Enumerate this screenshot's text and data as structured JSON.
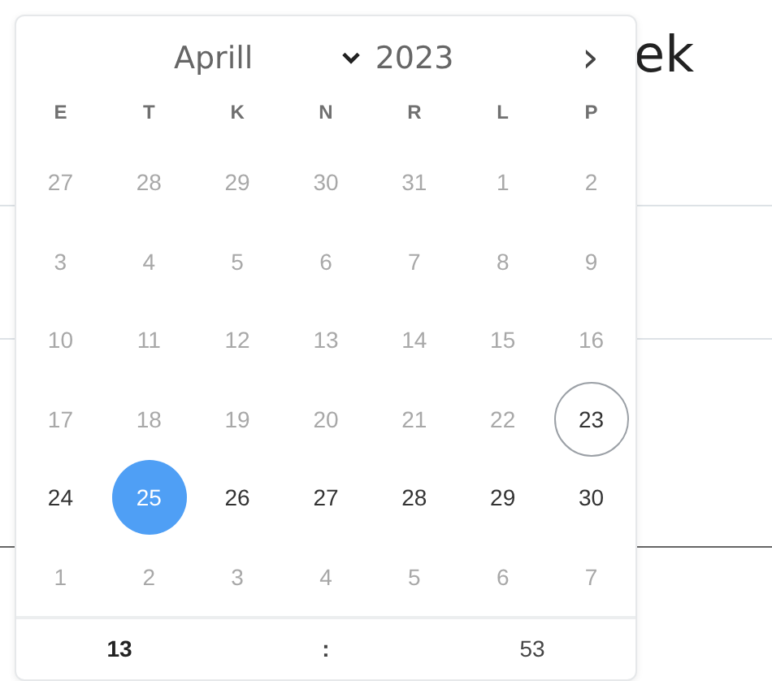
{
  "page": {
    "title": "ek"
  },
  "calendar": {
    "month": "Aprill",
    "year": "2023",
    "next": "›",
    "weekdays": [
      "E",
      "T",
      "K",
      "N",
      "R",
      "L",
      "P"
    ],
    "weeks": [
      [
        {
          "label": "27",
          "disabled": true,
          "today": false,
          "selected": false
        },
        {
          "label": "28",
          "disabled": true,
          "today": false,
          "selected": false
        },
        {
          "label": "29",
          "disabled": true,
          "today": false,
          "selected": false
        },
        {
          "label": "30",
          "disabled": true,
          "today": false,
          "selected": false
        },
        {
          "label": "31",
          "disabled": true,
          "today": false,
          "selected": false
        },
        {
          "label": "1",
          "disabled": true,
          "today": false,
          "selected": false
        },
        {
          "label": "2",
          "disabled": true,
          "today": false,
          "selected": false
        }
      ],
      [
        {
          "label": "3",
          "disabled": true,
          "today": false,
          "selected": false
        },
        {
          "label": "4",
          "disabled": true,
          "today": false,
          "selected": false
        },
        {
          "label": "5",
          "disabled": true,
          "today": false,
          "selected": false
        },
        {
          "label": "6",
          "disabled": true,
          "today": false,
          "selected": false
        },
        {
          "label": "7",
          "disabled": true,
          "today": false,
          "selected": false
        },
        {
          "label": "8",
          "disabled": true,
          "today": false,
          "selected": false
        },
        {
          "label": "9",
          "disabled": true,
          "today": false,
          "selected": false
        }
      ],
      [
        {
          "label": "10",
          "disabled": true,
          "today": false,
          "selected": false
        },
        {
          "label": "11",
          "disabled": true,
          "today": false,
          "selected": false
        },
        {
          "label": "12",
          "disabled": true,
          "today": false,
          "selected": false
        },
        {
          "label": "13",
          "disabled": true,
          "today": false,
          "selected": false
        },
        {
          "label": "14",
          "disabled": true,
          "today": false,
          "selected": false
        },
        {
          "label": "15",
          "disabled": true,
          "today": false,
          "selected": false
        },
        {
          "label": "16",
          "disabled": true,
          "today": false,
          "selected": false
        }
      ],
      [
        {
          "label": "17",
          "disabled": true,
          "today": false,
          "selected": false
        },
        {
          "label": "18",
          "disabled": true,
          "today": false,
          "selected": false
        },
        {
          "label": "19",
          "disabled": true,
          "today": false,
          "selected": false
        },
        {
          "label": "20",
          "disabled": true,
          "today": false,
          "selected": false
        },
        {
          "label": "21",
          "disabled": true,
          "today": false,
          "selected": false
        },
        {
          "label": "22",
          "disabled": true,
          "today": false,
          "selected": false
        },
        {
          "label": "23",
          "disabled": false,
          "today": true,
          "selected": false
        }
      ],
      [
        {
          "label": "24",
          "disabled": false,
          "today": false,
          "selected": false
        },
        {
          "label": "25",
          "disabled": false,
          "today": false,
          "selected": true
        },
        {
          "label": "26",
          "disabled": false,
          "today": false,
          "selected": false
        },
        {
          "label": "27",
          "disabled": false,
          "today": false,
          "selected": false
        },
        {
          "label": "28",
          "disabled": false,
          "today": false,
          "selected": false
        },
        {
          "label": "29",
          "disabled": false,
          "today": false,
          "selected": false
        },
        {
          "label": "30",
          "disabled": false,
          "today": false,
          "selected": false
        }
      ],
      [
        {
          "label": "1",
          "disabled": true,
          "today": false,
          "selected": false
        },
        {
          "label": "2",
          "disabled": true,
          "today": false,
          "selected": false
        },
        {
          "label": "3",
          "disabled": true,
          "today": false,
          "selected": false
        },
        {
          "label": "4",
          "disabled": true,
          "today": false,
          "selected": false
        },
        {
          "label": "5",
          "disabled": true,
          "today": false,
          "selected": false
        },
        {
          "label": "6",
          "disabled": true,
          "today": false,
          "selected": false
        },
        {
          "label": "7",
          "disabled": true,
          "today": false,
          "selected": false
        }
      ]
    ],
    "time": {
      "hour": "13",
      "separator": ":",
      "minute": "53"
    }
  }
}
